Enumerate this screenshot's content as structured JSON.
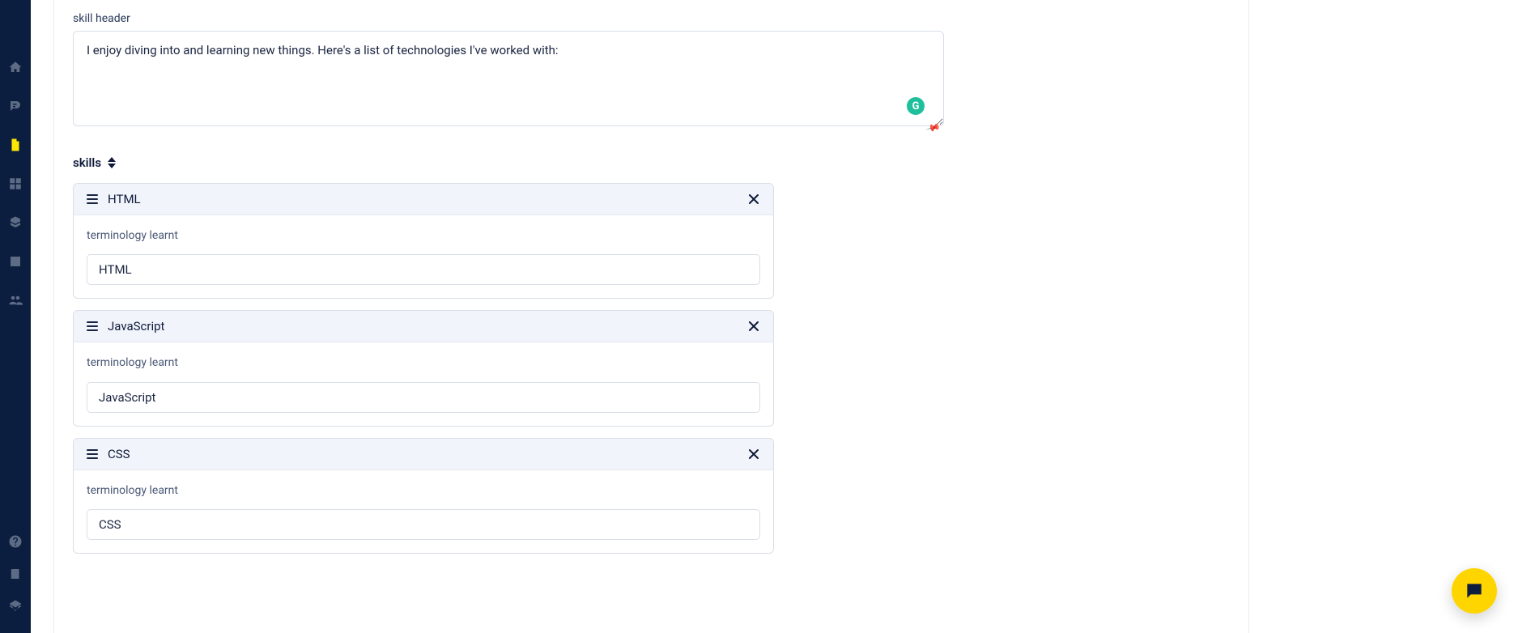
{
  "sidebar": {
    "items": [
      {
        "name": "home-icon"
      },
      {
        "name": "blog-icon"
      },
      {
        "name": "page-icon"
      },
      {
        "name": "grid-icon"
      },
      {
        "name": "components-icon"
      },
      {
        "name": "image-icon"
      },
      {
        "name": "users-icon"
      }
    ]
  },
  "header_field": {
    "label": "skill header",
    "value": "I enjoy diving into and learning new things. Here's a list of technologies I've worked with:"
  },
  "grammarly_glyph": "G",
  "section": {
    "title": "skills"
  },
  "terminology_label": "terminology learnt",
  "skills": [
    {
      "title": "HTML",
      "term": "HTML"
    },
    {
      "title": "JavaScript",
      "term": "JavaScript"
    },
    {
      "title": "CSS",
      "term": "CSS"
    }
  ]
}
